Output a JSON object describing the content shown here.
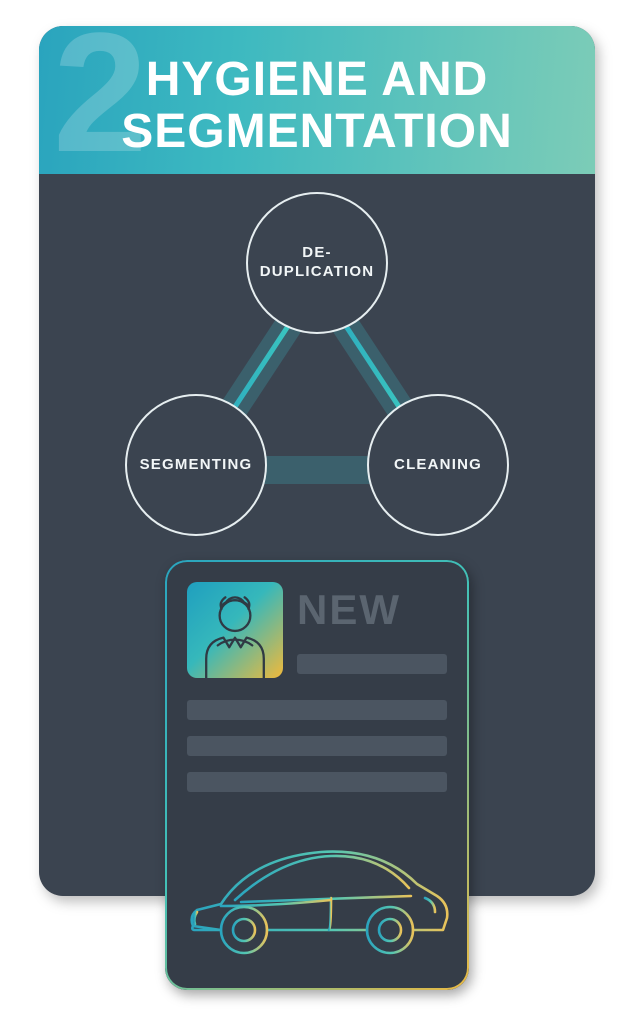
{
  "header": {
    "step_number": "2",
    "title_line1": "HYGIENE AND",
    "title_line2": "SEGMENTATION"
  },
  "triangle": {
    "top": "DE-\nDUPLICATION",
    "bottom_left": "SEGMENTING",
    "bottom_right": "CLEANING"
  },
  "profile": {
    "tag": "NEW"
  }
}
